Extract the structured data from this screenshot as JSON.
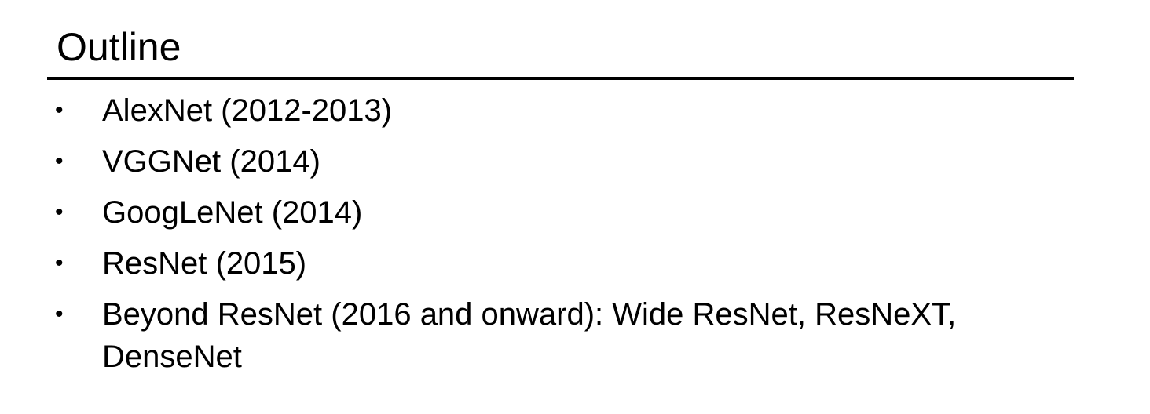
{
  "slide": {
    "title": "Outline",
    "bullet_glyph": "•",
    "items": [
      {
        "text": "AlexNet (2012-2013)"
      },
      {
        "text": "VGGNet (2014)"
      },
      {
        "text": "GoogLeNet (2014)"
      },
      {
        "text": "ResNet (2015)"
      },
      {
        "text": "Beyond ResNet (2016 and onward): Wide ResNet, ResNeXT, DenseNet"
      }
    ]
  }
}
